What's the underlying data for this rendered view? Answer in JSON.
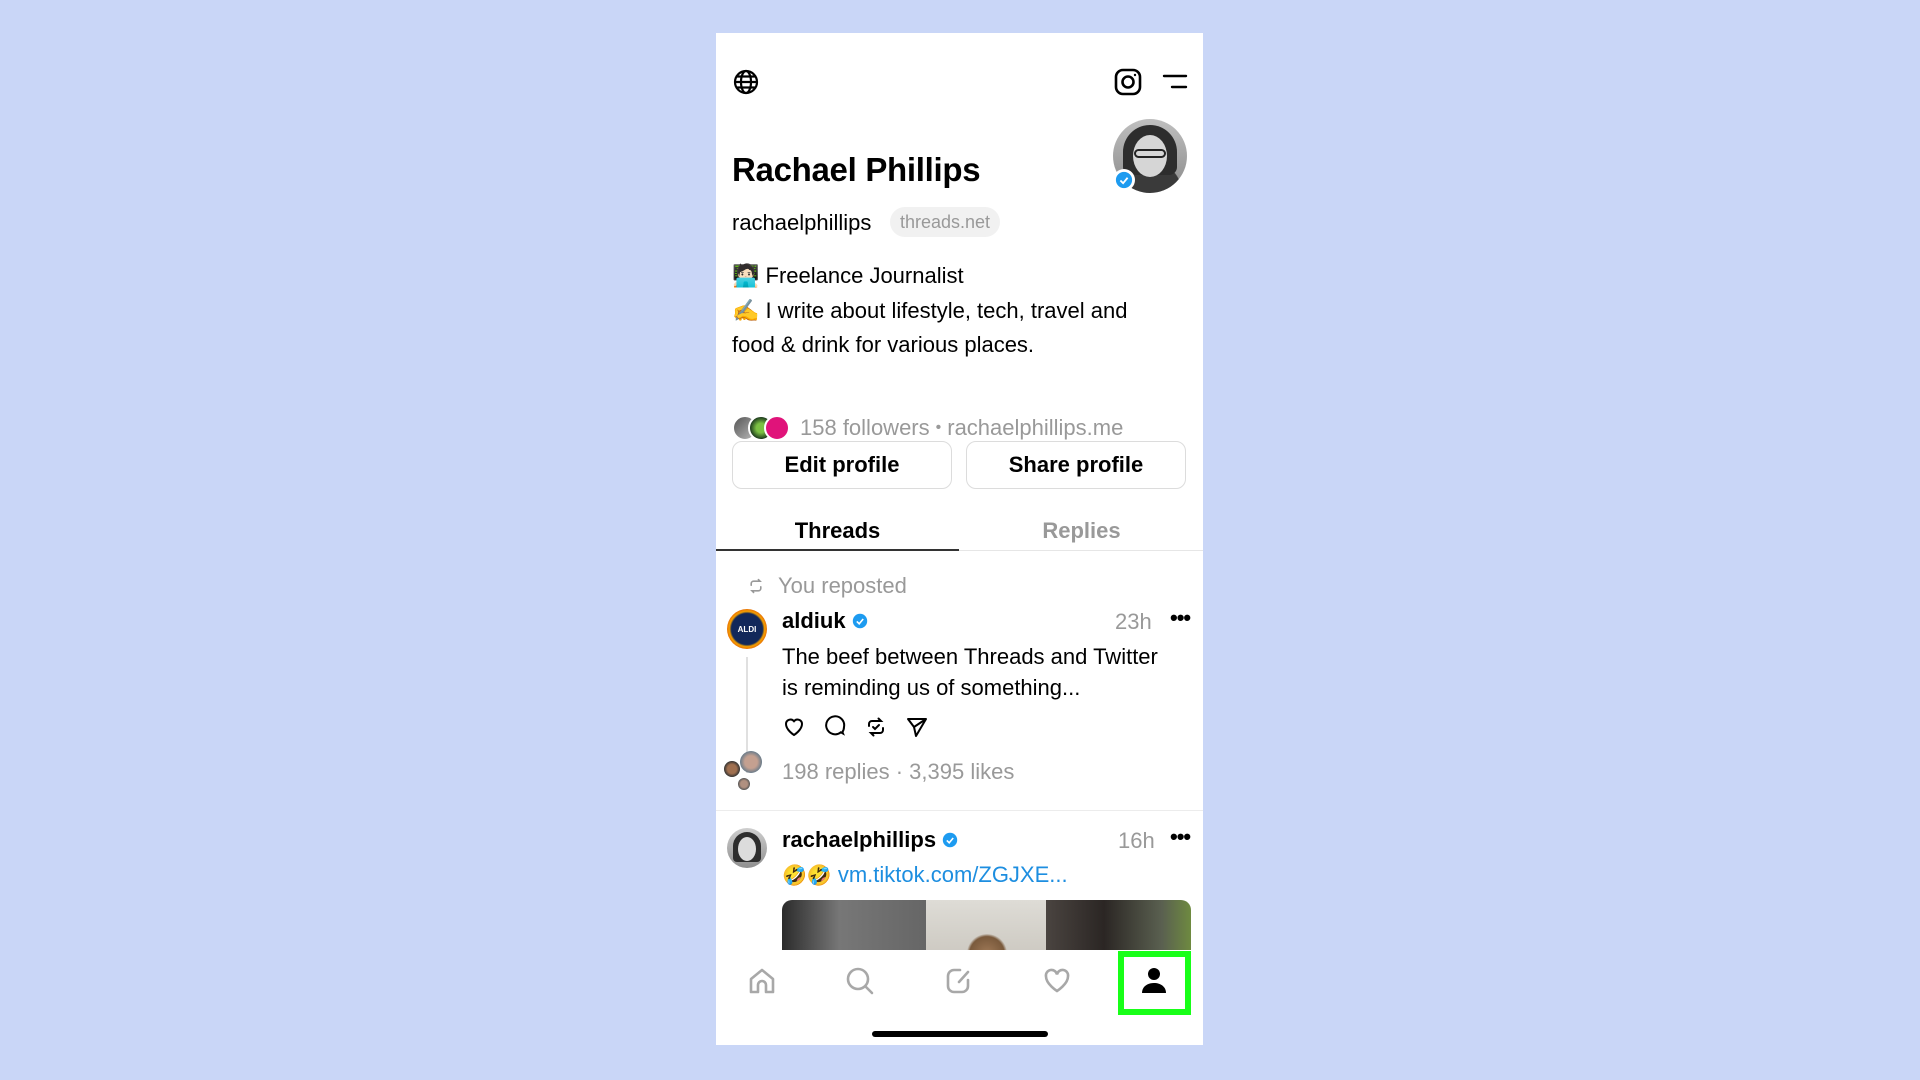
{
  "page": {
    "background_color": "#c9d6f7"
  },
  "header": {
    "left_icon": "globe-icon",
    "right_icons": [
      "instagram-icon",
      "menu-icon"
    ]
  },
  "profile": {
    "display_name": "Rachael Phillips",
    "username": "rachaelphillips",
    "domain_pill": "threads.net",
    "verified": true,
    "bio_lines": [
      "🧑🏻‍💻 Freelance Journalist",
      "✍️ I write about lifestyle, tech, travel and",
      "food & drink for various places."
    ],
    "followers_text": "158 followers",
    "separator": "•",
    "website": "rachaelphillips.me"
  },
  "buttons": {
    "edit_profile": "Edit profile",
    "share_profile": "Share profile"
  },
  "tabs": [
    {
      "label": "Threads",
      "active": true
    },
    {
      "label": "Replies",
      "active": false
    }
  ],
  "feed": [
    {
      "repost_label": "You reposted",
      "author": "aldiuk",
      "avatar_label": "ALDI",
      "verified": true,
      "time": "23h",
      "text_lines": [
        "The beef between Threads and Twitter",
        "is reminding us of something..."
      ],
      "stats": "198 replies · 3,395 likes"
    },
    {
      "author": "rachaelphillips",
      "verified": true,
      "time": "16h",
      "emoji": "🤣🤣",
      "link": "vm.tiktok.com/ZGJXE..."
    }
  ],
  "post_actions": [
    "heart-icon",
    "comment-icon",
    "repost-icon",
    "share-icon"
  ],
  "more_label": "•••",
  "bottom_nav": [
    {
      "name": "home",
      "active": false
    },
    {
      "name": "search",
      "active": false
    },
    {
      "name": "compose",
      "active": false
    },
    {
      "name": "activity",
      "active": false
    },
    {
      "name": "profile",
      "active": true,
      "highlighted": true
    }
  ],
  "colors": {
    "verified": "#1d9bf0",
    "link": "#1d8ee0",
    "muted_text": "#999999",
    "highlight_box": "#18ff18"
  }
}
